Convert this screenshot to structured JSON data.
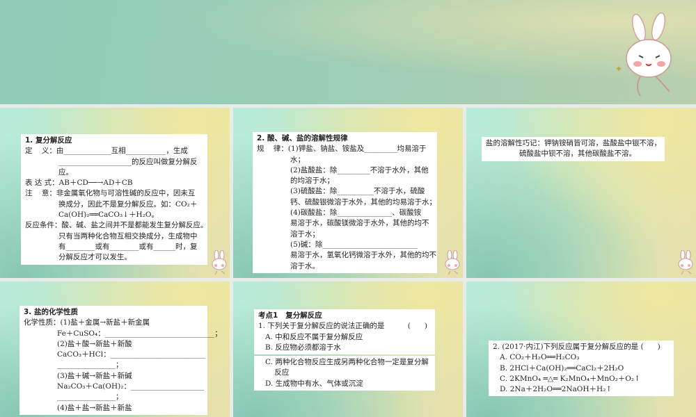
{
  "slides": [
    {
      "lines": [
        {
          "t": "1. 复分解反应",
          "c": "b"
        },
        {
          "t": "定    义：由_____________互相___________，生成"
        },
        {
          "t": "____________________的反应叫做复分解反",
          "c": "ind"
        },
        {
          "t": "应。",
          "c": "ind"
        },
        {
          "t": "表 达 式：AB＋CD──→AD＋CB"
        },
        {
          "t": "注    意：非金属氧化物与可溶性碱的反应中，因未互"
        },
        {
          "t": "换成分，因此不是复分解反应。如：CO₂＋",
          "c": "ind"
        },
        {
          "t": "Ca(OH)₂══CaCO₃↓＋H₂O。",
          "c": "ind"
        },
        {
          "t": "反应条件：酸、碱、盐之间并不是都能发生复分解反应。"
        },
        {
          "t": "只有当两种化合物互相交换成分，生成物中",
          "c": "ind"
        },
        {
          "t": "有________或有________或有______时，复",
          "c": "ind"
        },
        {
          "t": "分解反应才可以发生。",
          "c": "ind"
        }
      ]
    },
    {
      "lines": [
        {
          "t": "2. 酸、碱、盐的溶解性规律",
          "c": "b"
        },
        {
          "t": "规    律：(1)钾盐、钠盐、铵盐及_________均易溶于"
        },
        {
          "t": "水；",
          "c": "ind"
        },
        {
          "t": "(2)盐酸盐：除_________不溶于水外，其他",
          "c": "ind"
        },
        {
          "t": "的均溶于水；",
          "c": "ind"
        },
        {
          "t": "(3)硫酸盐：除__________不溶于水，硫酸",
          "c": "ind"
        },
        {
          "t": "钙、硫酸银微溶于水外，其他的均易溶于水；",
          "c": "ind"
        },
        {
          "t": "(4)碳酸盐：除_______________、碳酸铵",
          "c": "ind"
        },
        {
          "t": "易溶于水，碳酸镁微溶于水外，其他的均不",
          "c": "ind"
        },
        {
          "t": "溶于水；",
          "c": "ind"
        },
        {
          "t": "(5)碱：除__________________________",
          "c": "ind"
        },
        {
          "t": "易溶于水，氢氧化钙微溶于水外，其他的均不",
          "c": "ind"
        },
        {
          "t": "溶于水。",
          "c": "ind"
        }
      ]
    },
    {
      "lines": [
        {
          "t": "盐的溶解性巧记：钾钠铵硝皆可溶，盐酸盐中银不溶，"
        },
        {
          "t": "硫酸盐中钡不溶，其他碳酸盐不溶。",
          "c": "ind"
        }
      ]
    },
    {
      "lines": [
        {
          "t": "3. 盐的化学性质",
          "c": "b"
        },
        {
          "t": "化学性质：(1)盐＋金属→新盐＋新金属"
        },
        {
          "t": "Fe＋CuSO₄：______________________________；",
          "c": "ind"
        },
        {
          "t": "(2)盐＋酸→新盐＋新酸",
          "c": "ind"
        },
        {
          "t": "CaCO₃＋HCl：__________________________",
          "c": "ind"
        },
        {
          "t": "________________；",
          "c": "ind"
        },
        {
          "t": "(3)盐＋碱→新盐＋新碱",
          "c": "ind"
        },
        {
          "t": "Na₂CO₃＋Ca(OH)₂：____________________",
          "c": "ind"
        },
        {
          "t": "________________；",
          "c": "ind"
        },
        {
          "t": "(4)盐＋盐→新盐＋新盐",
          "c": "ind"
        }
      ]
    },
    {
      "lines": [
        {
          "t": "考点1   复分解反应",
          "c": "b"
        },
        {
          "t": "1. 下列关于复分解反应的说法正确的是          (      )"
        },
        {
          "t": "A. 中和反应不属于复分解反应",
          "c": "ind2"
        },
        {
          "t": "B. 反应物必须都溶于水",
          "c": "ind2"
        }
      ],
      "lines2": [
        {
          "t": "C. 两种化合物反应生成另两种化合物一定是复分解",
          "c": "ind2"
        },
        {
          "t": "    反应",
          "c": "ind2"
        },
        {
          "t": "D. 生成物中有水、气体或沉淀",
          "c": "ind2"
        }
      ]
    },
    {
      "lines": [
        {
          "t": "2. (2017·内江)下列反应属于复分解反应的是 (      )"
        },
        {
          "t": "A. CO₂＋H₂O══H₂CO₃",
          "c": "ind2"
        },
        {
          "t": "B. 2HCl＋Ca(OH)₂══CaCl₂＋2H₂O",
          "c": "ind2"
        },
        {
          "t": "C. 2KMnO₄ ═△═ K₂MnO₄＋MnO₂＋O₂↑",
          "c": "ind2"
        },
        {
          "t": "D. 2Na＋2H₂O══2NaOH＋H₂↑",
          "c": "ind2"
        }
      ]
    }
  ]
}
